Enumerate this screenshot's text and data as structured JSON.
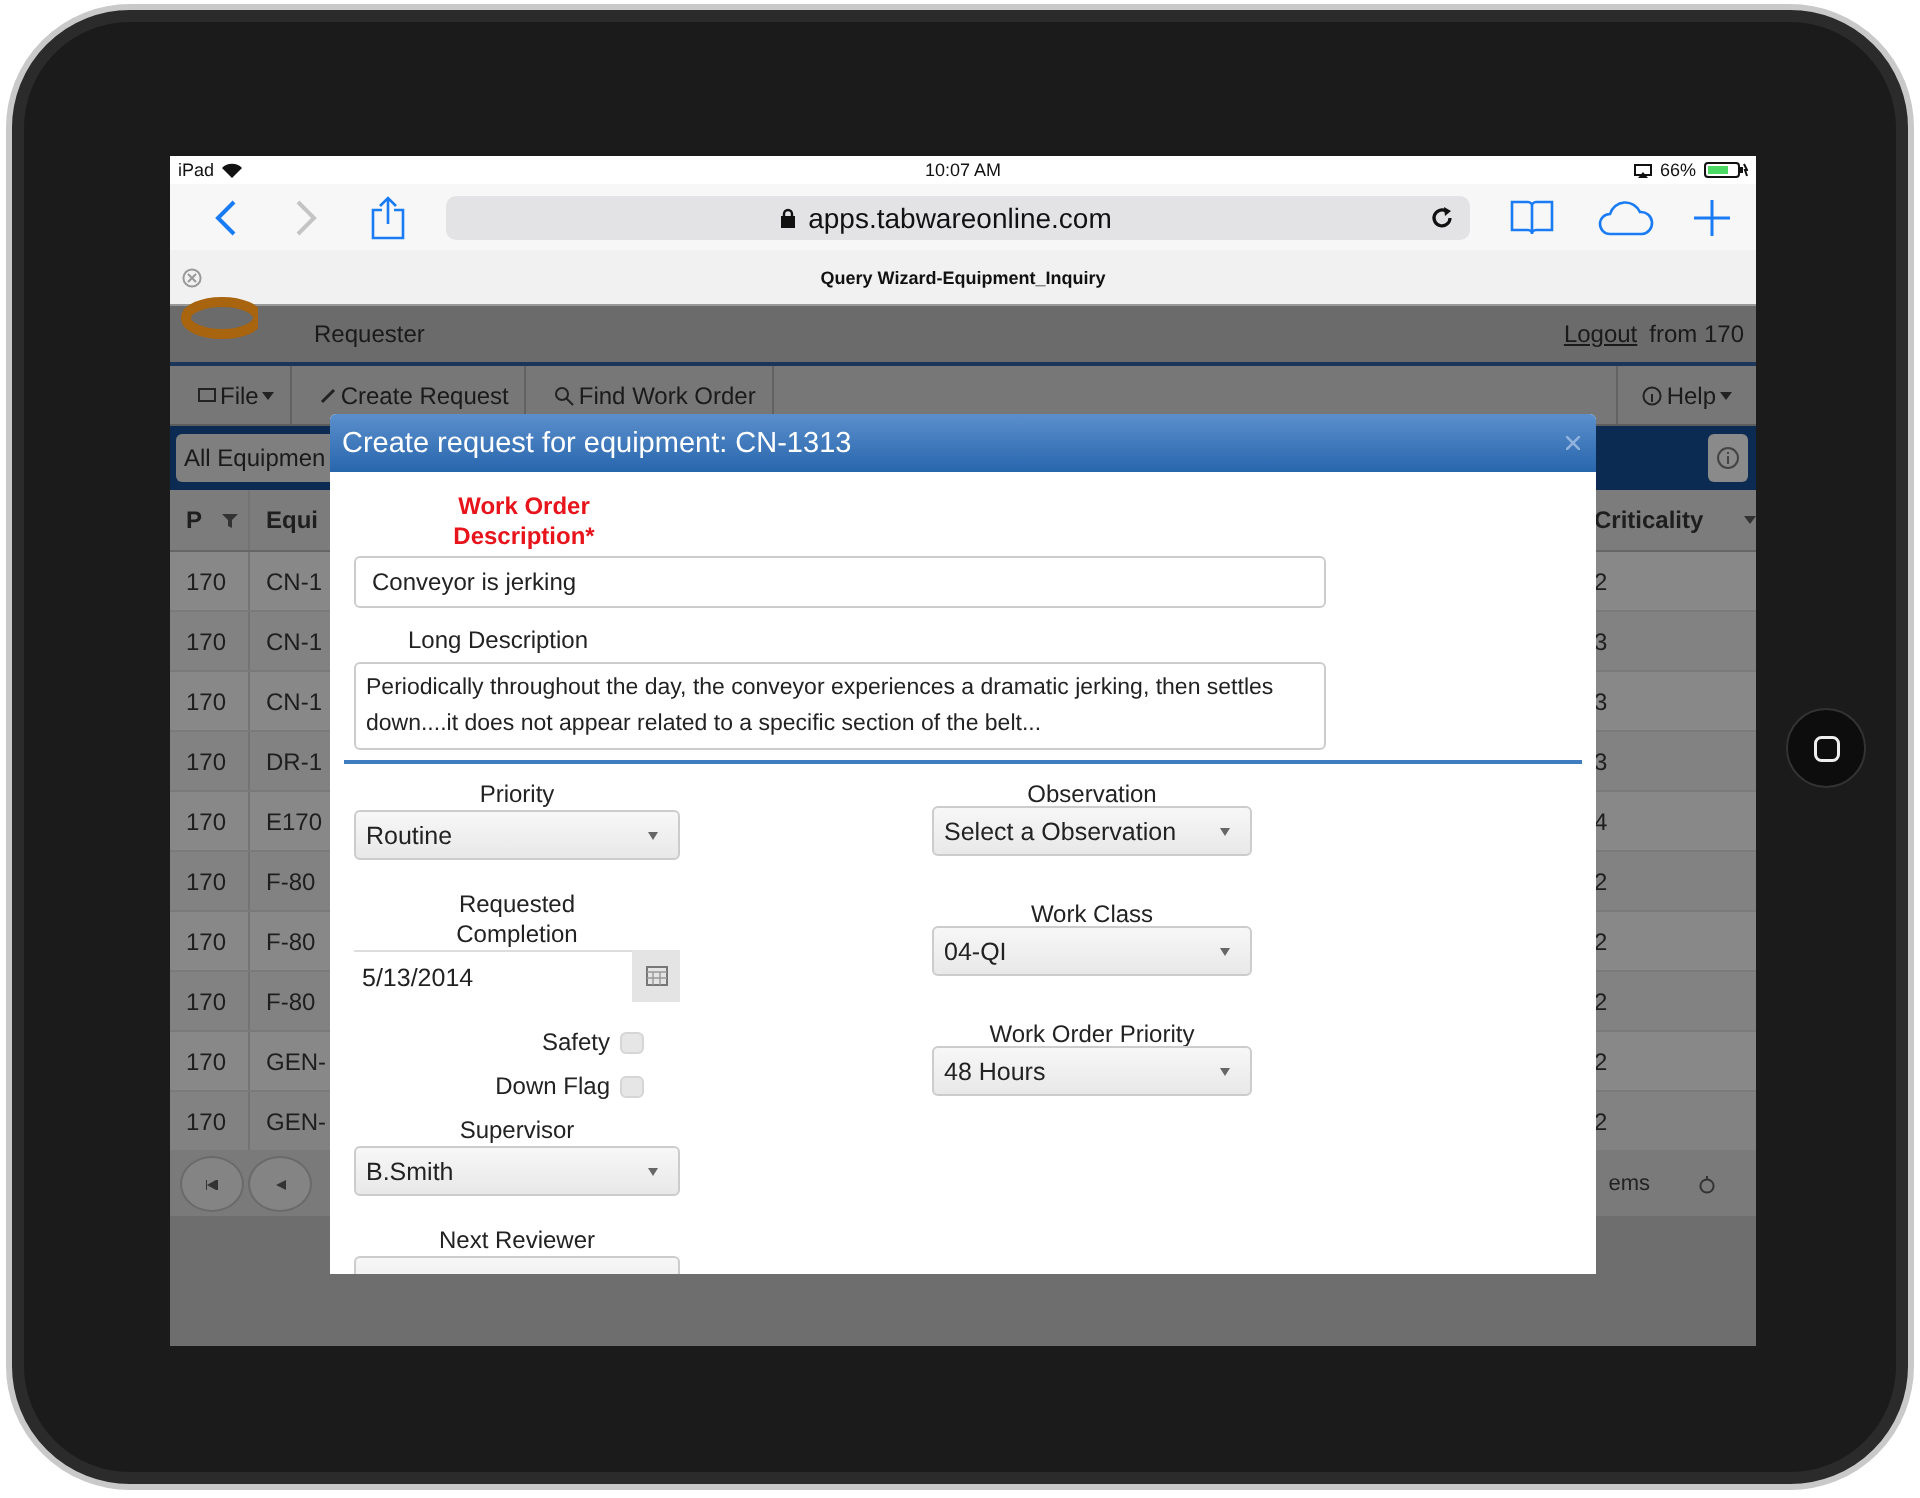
{
  "status_bar": {
    "device": "iPad",
    "time": "10:07 AM",
    "battery": "66%"
  },
  "browser": {
    "url": "apps.tabwareonline.com",
    "tab_title": "Query Wizard-Equipment_Inquiry"
  },
  "app": {
    "role": "Requester",
    "logout": "Logout",
    "from": "from 170",
    "menu": [
      {
        "label": "File",
        "dropdown": true
      },
      {
        "label": "Create Request",
        "dropdown": false
      },
      {
        "label": "Find Work Order",
        "dropdown": false
      },
      {
        "label": "Help",
        "dropdown": true
      }
    ],
    "filter": "All Equipmen",
    "table": {
      "columns": [
        "P",
        "Equi",
        "Criticality"
      ],
      "rows": [
        [
          "170",
          "CN-1",
          "2"
        ],
        [
          "170",
          "CN-1",
          "3"
        ],
        [
          "170",
          "CN-1",
          "3"
        ],
        [
          "170",
          "DR-1",
          "3"
        ],
        [
          "170",
          "E170",
          "4"
        ],
        [
          "170",
          "F-80",
          "2"
        ],
        [
          "170",
          "F-80",
          "2"
        ],
        [
          "170",
          "F-80",
          "2"
        ],
        [
          "170",
          "GEN-",
          "2"
        ],
        [
          "170",
          "GEN-",
          "2"
        ]
      ]
    },
    "pager_text": "ems"
  },
  "dialog": {
    "title": "Create request for equipment: CN-1313",
    "description": {
      "label": "Work Order Description*",
      "required": true,
      "value": "Conveyor is jerking"
    },
    "long_description": {
      "label": "Long Description",
      "required": false,
      "value": "Periodically throughout the day, the conveyor experiences a dramatic jerking, then settles down....it does not appear related to a specific section of the belt..."
    },
    "left_fields": [
      {
        "kind": "select",
        "label": "Priority",
        "value": "Routine"
      },
      {
        "kind": "date",
        "label": "Requested Completion",
        "value": "5/13/2014"
      },
      {
        "kind": "checkbox",
        "label": "Safety",
        "checked": false
      },
      {
        "kind": "checkbox",
        "label": "Down Flag",
        "checked": false
      },
      {
        "kind": "select",
        "label": "Supervisor",
        "value": "B.Smith"
      },
      {
        "kind": "select",
        "label": "Next Reviewer"
      }
    ],
    "right_fields": [
      {
        "kind": "select",
        "label": "Observation",
        "value": "Select a Observation"
      },
      {
        "kind": "select",
        "label": "Work Class",
        "value": "04-QI"
      },
      {
        "kind": "select",
        "label": "Work Order Priority",
        "value": "48 Hours"
      }
    ]
  }
}
